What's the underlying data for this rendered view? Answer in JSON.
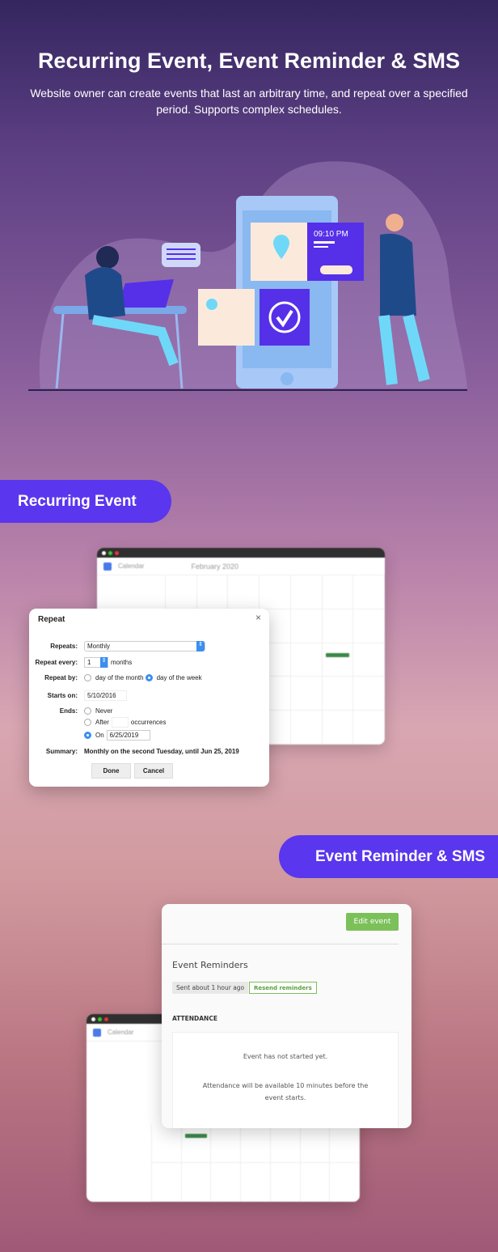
{
  "header": {
    "title": "Recurring Event, Event Reminder & SMS",
    "subtitle": "Website owner can create events that last an arbitrary time, and repeat over a specified period. Supports complex schedules."
  },
  "illustration": {
    "clock_time": "09:10 PM"
  },
  "sections": [
    {
      "label": "Recurring Event"
    },
    {
      "label": "Event Reminder & SMS"
    }
  ],
  "calendar": {
    "app_name": "Calendar",
    "month": "February 2020",
    "event_color": "#3a8a48"
  },
  "repeat_dialog": {
    "title": "Repeat",
    "repeats_label": "Repeats:",
    "repeats_value": "Monthly",
    "every_label": "Repeat every:",
    "every_value": "1",
    "every_unit": "months",
    "by_label": "Repeat by:",
    "by_options": [
      "day of the month",
      "day of the week"
    ],
    "by_selected": "day of the week",
    "starts_label": "Starts on:",
    "starts_value": "5/10/2016",
    "ends_label": "Ends:",
    "ends_never": "Never",
    "ends_after": "After",
    "ends_after_unit": "occurrences",
    "ends_on": "On",
    "ends_on_value": "6/25/2019",
    "summary_label": "Summary:",
    "summary_value": "Monthly on the second Tuesday, until Jun 25, 2019",
    "done": "Done",
    "cancel": "Cancel"
  },
  "event_card": {
    "edit_button": "Edit event",
    "reminders_title": "Event Reminders",
    "sent_badge": "Sent about 1 hour ago",
    "resend_button": "Resend reminders",
    "attendance_heading": "ATTENDANCE",
    "status": "Event has not started yet.",
    "note": "Attendance will be available 10 minutes before the event starts."
  },
  "colors": {
    "accent": "#5a36ee",
    "green": "#7cc05a"
  }
}
